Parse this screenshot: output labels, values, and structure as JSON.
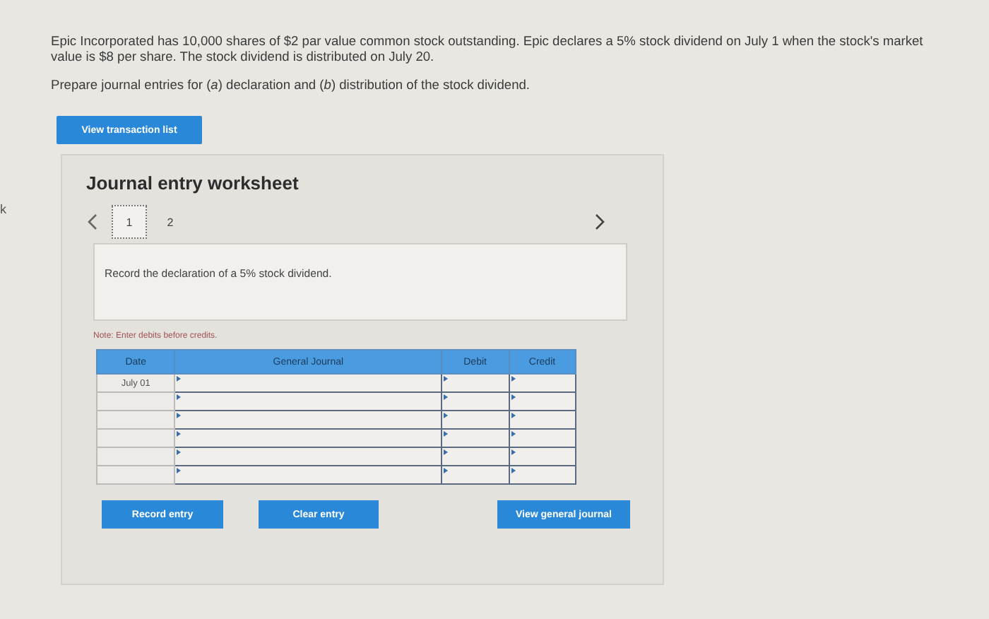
{
  "edge_text": "k",
  "question": {
    "paragraphs": [
      "Epic Incorporated has 10,000 shares of $2 par value common stock outstanding. Epic declares a 5% stock dividend on July 1 when the stock's market value is $8 per share. The stock dividend is distributed on July 20.",
      "Prepare journal entries for (*a*) declaration and (*b*) distribution of the stock dividend."
    ]
  },
  "view_transaction_button": "View transaction list",
  "worksheet": {
    "title": "Journal entry worksheet",
    "tabs": [
      {
        "label": "1",
        "selected": true
      },
      {
        "label": "2",
        "selected": false
      }
    ],
    "prompt": "Record the declaration of a 5% stock dividend.",
    "note": "Note: Enter debits before credits.",
    "table": {
      "columns": [
        "Date",
        "General Journal",
        "Debit",
        "Credit"
      ],
      "rows": [
        {
          "date": "July 01"
        },
        {},
        {},
        {},
        {},
        {}
      ]
    },
    "buttons": [
      "Record entry",
      "Clear entry",
      "View general journal"
    ]
  }
}
